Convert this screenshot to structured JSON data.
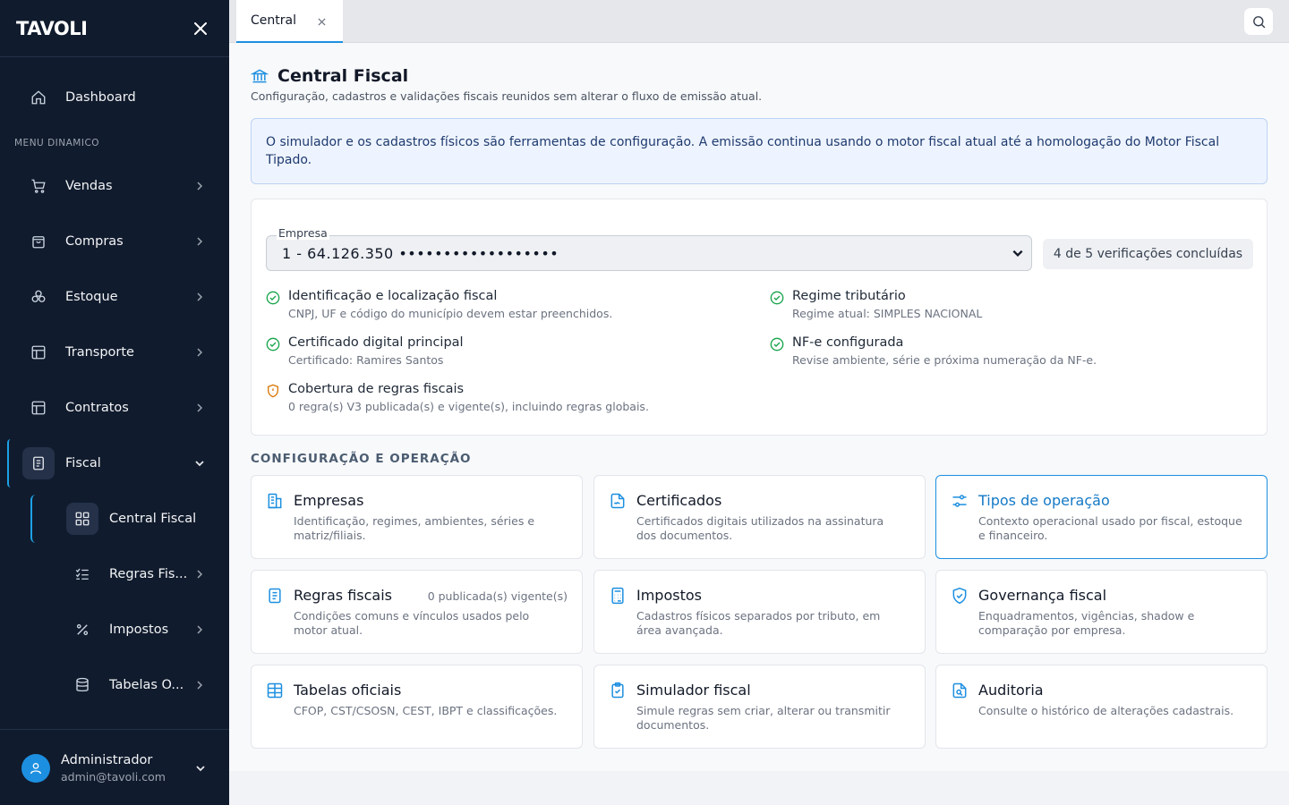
{
  "app": {
    "logo": "TAVOLI"
  },
  "sidebar": {
    "dashboard": "Dashboard",
    "menu_caption": "MENU DINAMICO",
    "items": [
      {
        "label": "Vendas",
        "icon": "cart-icon"
      },
      {
        "label": "Compras",
        "icon": "shopping-bag-icon"
      },
      {
        "label": "Estoque",
        "icon": "boxes-icon"
      },
      {
        "label": "Transporte",
        "icon": "layout-icon"
      },
      {
        "label": "Contratos",
        "icon": "layout-icon"
      },
      {
        "label": "Fiscal",
        "icon": "document-icon"
      }
    ],
    "sub_items": [
      {
        "label": "Central Fiscal",
        "icon": "grid-icon"
      },
      {
        "label": "Regras Fis...",
        "icon": "list-check-icon"
      },
      {
        "label": "Impostos",
        "icon": "percent-icon"
      },
      {
        "label": "Tabelas O...",
        "icon": "database-icon"
      }
    ],
    "user": {
      "name": "Administrador",
      "email": "admin@tavoli.com"
    }
  },
  "topbar": {
    "tab": "Central"
  },
  "page": {
    "title": "Central Fiscal",
    "subtitle": "Configuração, cadastros e validações fiscais reunidos sem alterar o fluxo de emissão atual.",
    "notice": "O simulador e os cadastros físicos são ferramentas de configuração. A emissão continua usando o motor fiscal atual até a homologação do Motor Fiscal Tipado."
  },
  "company": {
    "label": "Empresa",
    "value": "1 - 64.126.350 ••••••••••••••••••",
    "verifications": "4 de 5 verificações concluídas"
  },
  "checks": [
    {
      "title": "Identificação e localização fiscal",
      "desc": "CNPJ, UF e código do município devem estar preenchidos.",
      "status": "ok"
    },
    {
      "title": "Regime tributário",
      "desc": "Regime atual: SIMPLES NACIONAL",
      "status": "ok"
    },
    {
      "title": "Certificado digital principal",
      "desc": "Certificado: Ramires Santos",
      "status": "ok"
    },
    {
      "title": "NF-e configurada",
      "desc": "Revise ambiente, série e próxima numeração da NF-e.",
      "status": "ok"
    },
    {
      "title": "Cobertura de regras fiscais",
      "desc": "0 regra(s) V3 publicada(s) e vigente(s), incluindo regras globais.",
      "status": "warning"
    }
  ],
  "section": {
    "title": "CONFIGURAÇÃO E OPERAÇÃO"
  },
  "cards": [
    {
      "title": "Empresas",
      "desc": "Identificação, regimes, ambientes, séries e matriz/filiais.",
      "icon": "building-icon",
      "meta": ""
    },
    {
      "title": "Certificados",
      "desc": "Certificados digitais utilizados na assinatura dos documentos.",
      "icon": "file-signature-icon",
      "meta": ""
    },
    {
      "title": "Tipos de operação",
      "desc": "Contexto operacional usado por fiscal, estoque e financeiro.",
      "icon": "sliders-icon",
      "meta": ""
    },
    {
      "title": "Regras fiscais",
      "desc": "Condições comuns e vínculos usados pelo motor atual.",
      "icon": "file-text-icon",
      "meta": "0 publicada(s) vigente(s)"
    },
    {
      "title": "Impostos",
      "desc": "Cadastros físicos separados por tributo, em área avançada.",
      "icon": "calculator-icon",
      "meta": ""
    },
    {
      "title": "Governança fiscal",
      "desc": "Enquadramentos, vigências, shadow e comparação por empresa.",
      "icon": "shield-check-icon",
      "meta": ""
    },
    {
      "title": "Tabelas oficiais",
      "desc": "CFOP, CST/CSOSN, CEST, IBPT e classificações.",
      "icon": "table-icon",
      "meta": ""
    },
    {
      "title": "Simulador fiscal",
      "desc": "Simule regras sem criar, alterar ou transmitir documentos.",
      "icon": "clipboard-check-icon",
      "meta": ""
    },
    {
      "title": "Auditoria",
      "desc": "Consulte o histórico de alterações cadastrais.",
      "icon": "file-search-icon",
      "meta": ""
    }
  ],
  "colors": {
    "sidebar_bg": "#101b2d",
    "accent": "#1d8fe0",
    "ok": "#16a34a",
    "warning": "#d97706"
  }
}
